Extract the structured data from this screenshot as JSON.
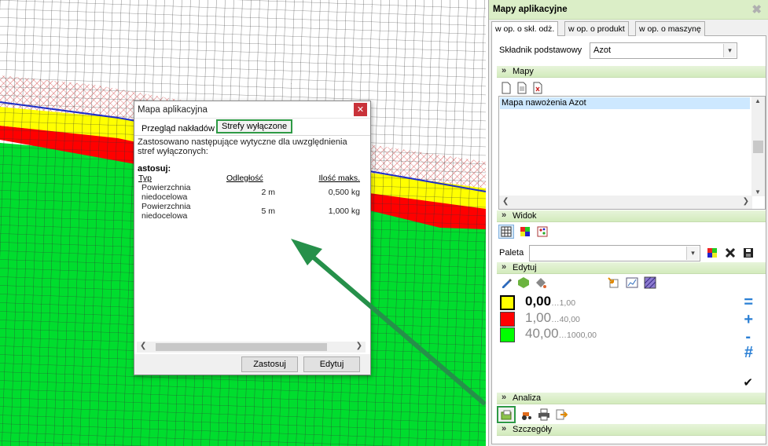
{
  "dialog": {
    "title": "Mapa aplikacyjna",
    "close_glyph": "✕",
    "tabs": [
      "Przegląd nakładów",
      "Strefy wyłączone"
    ],
    "intro": "Zastosowano następujące wytyczne dla uwzględnienia stref wyłączonych:",
    "section": "astosuj:",
    "columns": [
      "Typ",
      "Odległość",
      "Ilość maks."
    ],
    "rows": [
      [
        "Powierzchnia niedocelowa",
        "2 m",
        "0,500 kg"
      ],
      [
        "Powierzchnia niedocelowa",
        "5 m",
        "1,000 kg"
      ]
    ],
    "apply_label": "Zastosuj",
    "edit_label": "Edytuj"
  },
  "panel": {
    "title": "Mapy aplikacyjne",
    "close_glyph": "✖",
    "tabs": [
      "w op. o skł. odż.",
      "w op. o produkt",
      "w op. o maszynę"
    ],
    "nutrient_label": "Składnik podstawowy",
    "nutrient_value": "Azot",
    "maps_header": "Mapy",
    "maps_list": [
      "Mapa nawożenia Azot"
    ],
    "view_header": "Widok",
    "palette_label": "Paleta",
    "palette_value": "",
    "edit_header": "Edytuj",
    "legend": [
      {
        "color": "#ffff00",
        "value": "0,00",
        "range": "…1,00",
        "bold": true
      },
      {
        "color": "#ff0000",
        "value": "1,00",
        "range": "…40,00",
        "bold": false
      },
      {
        "color": "#00ff00",
        "value": "40,00",
        "range": "…1000,00",
        "bold": false
      }
    ],
    "legend_symbols": [
      "=",
      "+",
      "-",
      "#"
    ],
    "check_glyph": "✔",
    "analysis_header": "Analiza",
    "details_header": "Szczegóły"
  },
  "colors": {
    "map_green": "#00dd2e",
    "map_red": "#ff0000",
    "map_yellow": "#ffff00",
    "highlight_green": "#2e9a45",
    "panel_header": "#dbeec7"
  }
}
